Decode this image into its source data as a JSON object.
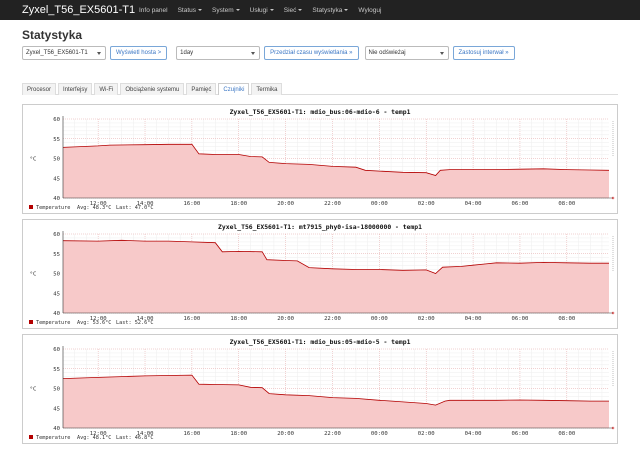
{
  "navbar": {
    "brand": "Zyxel_T56_EX5601-T1",
    "items": [
      {
        "label": "Info panel",
        "dropdown": false
      },
      {
        "label": "Status",
        "dropdown": true
      },
      {
        "label": "System",
        "dropdown": true
      },
      {
        "label": "Usługi",
        "dropdown": true
      },
      {
        "label": "Sieć",
        "dropdown": true
      },
      {
        "label": "Statystyka",
        "dropdown": true
      },
      {
        "label": "Wyloguj",
        "dropdown": false
      }
    ]
  },
  "page": {
    "title": "Statystyka"
  },
  "controls": {
    "host_select": "Zyxel_T56_EX5601-T1",
    "host_button": "Wyświetl hosta >",
    "timespan_select": "1day",
    "timespan_button": "Przedział czasu wyświetlania »",
    "refresh_select": "Nie odświeżaj",
    "interval_button": "Zastosuj interwał »"
  },
  "tabs": [
    {
      "label": "Procesor",
      "active": false
    },
    {
      "label": "Interfejsy",
      "active": false
    },
    {
      "label": "Wi-Fi",
      "active": false
    },
    {
      "label": "Obciążenie systemu",
      "active": false
    },
    {
      "label": "Pamięć",
      "active": false
    },
    {
      "label": "Czujniki",
      "active": true
    },
    {
      "label": "Termika",
      "active": false
    }
  ],
  "colors": {
    "navbar_bg": "#222222",
    "accent": "#3a76c4",
    "area_fill": "#f7c9c9",
    "area_line": "#b30000",
    "grid_major": "#d9a0a0"
  },
  "graphs": [
    {
      "title": "Zyxel_T56_EX5601-T1: mdio_bus:06-mdio-6 - temp1",
      "legend": {
        "name": "Temperature",
        "avg": "Avg: 48.3°C",
        "last": "Last: 47.0°C"
      },
      "chart_data": {
        "type": "area",
        "y_ticks": [
          "40",
          "45",
          "50",
          "55",
          "60"
        ],
        "x_ticks": [
          "12:00",
          "14:00",
          "16:00",
          "18:00",
          "20:00",
          "22:00",
          "00:00",
          "02:00",
          "04:00",
          "06:00",
          "08:00"
        ],
        "ylim": [
          40,
          60
        ],
        "xlim": [
          10.5,
          33.8
        ],
        "ylabel": "°C",
        "points": [
          [
            10.5,
            52.8
          ],
          [
            12.0,
            53.2
          ],
          [
            12.5,
            53.4
          ],
          [
            14.0,
            53.5
          ],
          [
            15.0,
            53.6
          ],
          [
            16.0,
            53.6
          ],
          [
            16.3,
            51.2
          ],
          [
            17.0,
            51.0
          ],
          [
            18.0,
            51.0
          ],
          [
            18.5,
            50.5
          ],
          [
            19.0,
            50.4
          ],
          [
            19.3,
            49.0
          ],
          [
            20.0,
            48.7
          ],
          [
            21.0,
            48.5
          ],
          [
            22.0,
            48.0
          ],
          [
            23.0,
            47.8
          ],
          [
            23.4,
            47.0
          ],
          [
            24.0,
            46.8
          ],
          [
            25.0,
            46.5
          ],
          [
            26.0,
            46.4
          ],
          [
            26.4,
            45.7
          ],
          [
            26.6,
            47.0
          ],
          [
            27.0,
            47.2
          ],
          [
            28.0,
            47.2
          ],
          [
            29.0,
            47.2
          ],
          [
            30.0,
            47.3
          ],
          [
            31.0,
            47.4
          ],
          [
            32.0,
            47.2
          ],
          [
            33.0,
            47.1
          ],
          [
            33.8,
            47.0
          ]
        ]
      }
    },
    {
      "title": "Zyxel_T56_EX5601-T1: mt7915_phy0-isa-18000000 - temp1",
      "legend": {
        "name": "Temperature",
        "avg": "Avg: 53.6°C",
        "last": "Last: 52.6°C"
      },
      "chart_data": {
        "type": "area",
        "y_ticks": [
          "40",
          "45",
          "50",
          "55",
          "60"
        ],
        "x_ticks": [
          "12:00",
          "14:00",
          "16:00",
          "18:00",
          "20:00",
          "22:00",
          "00:00",
          "02:00",
          "04:00",
          "06:00",
          "08:00"
        ],
        "ylim": [
          40,
          60
        ],
        "xlim": [
          10.5,
          33.8
        ],
        "ylabel": "°C",
        "points": [
          [
            10.5,
            58.3
          ],
          [
            12.0,
            58.2
          ],
          [
            13.0,
            58.4
          ],
          [
            14.0,
            58.2
          ],
          [
            15.0,
            58.2
          ],
          [
            16.0,
            58.0
          ],
          [
            17.0,
            57.8
          ],
          [
            17.3,
            55.5
          ],
          [
            18.0,
            55.6
          ],
          [
            19.0,
            55.5
          ],
          [
            19.2,
            53.5
          ],
          [
            20.0,
            53.3
          ],
          [
            20.5,
            53.2
          ],
          [
            21.0,
            51.5
          ],
          [
            22.0,
            51.2
          ],
          [
            23.0,
            51.0
          ],
          [
            24.0,
            51.0
          ],
          [
            25.0,
            50.8
          ],
          [
            26.0,
            50.9
          ],
          [
            26.4,
            50.0
          ],
          [
            26.7,
            51.6
          ],
          [
            27.5,
            51.8
          ],
          [
            28.0,
            52.1
          ],
          [
            28.5,
            52.4
          ],
          [
            29.0,
            52.7
          ],
          [
            30.0,
            52.6
          ],
          [
            31.0,
            52.8
          ],
          [
            32.0,
            52.7
          ],
          [
            33.0,
            52.6
          ],
          [
            33.8,
            52.6
          ]
        ]
      }
    },
    {
      "title": "Zyxel_T56_EX5601-T1: mdio_bus:05-mdio-5 - temp1",
      "legend": {
        "name": "Temperature",
        "avg": "Avg: 48.1°C",
        "last": "Last: 46.8°C"
      },
      "chart_data": {
        "type": "area",
        "y_ticks": [
          "40",
          "45",
          "50",
          "55",
          "60"
        ],
        "x_ticks": [
          "12:00",
          "14:00",
          "16:00",
          "18:00",
          "20:00",
          "22:00",
          "00:00",
          "02:00",
          "04:00",
          "06:00",
          "08:00"
        ],
        "ylim": [
          40,
          60
        ],
        "xlim": [
          10.5,
          33.8
        ],
        "ylabel": "°C",
        "points": [
          [
            10.5,
            52.5
          ],
          [
            12.0,
            52.8
          ],
          [
            13.0,
            53.0
          ],
          [
            14.0,
            53.2
          ],
          [
            15.0,
            53.3
          ],
          [
            16.0,
            53.4
          ],
          [
            16.3,
            51.1
          ],
          [
            17.0,
            51.0
          ],
          [
            18.0,
            50.9
          ],
          [
            18.5,
            50.3
          ],
          [
            19.0,
            50.2
          ],
          [
            19.3,
            48.7
          ],
          [
            20.0,
            48.4
          ],
          [
            21.0,
            48.2
          ],
          [
            22.0,
            47.7
          ],
          [
            23.0,
            47.5
          ],
          [
            24.0,
            47.0
          ],
          [
            25.0,
            46.6
          ],
          [
            26.0,
            46.2
          ],
          [
            26.4,
            45.8
          ],
          [
            26.8,
            46.8
          ],
          [
            27.0,
            47.0
          ],
          [
            28.0,
            47.0
          ],
          [
            29.0,
            47.0
          ],
          [
            30.0,
            47.1
          ],
          [
            31.0,
            47.0
          ],
          [
            32.0,
            46.9
          ],
          [
            33.0,
            46.8
          ],
          [
            33.8,
            46.8
          ]
        ]
      }
    }
  ]
}
